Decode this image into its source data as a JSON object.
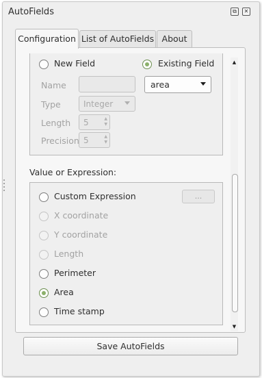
{
  "window": {
    "title": "AutoFields",
    "float_button": "⧉",
    "close_button": "✕"
  },
  "tabs": [
    {
      "label": "Configuration",
      "active": true
    },
    {
      "label": "List of AutoFields",
      "active": false
    },
    {
      "label": "About",
      "active": false
    }
  ],
  "field_target": {
    "new_field_label": "New Field",
    "existing_field_label": "Existing Field",
    "selected": "Existing Field",
    "existing_field_value": "area",
    "name_label": "Name",
    "name_value": "",
    "type_label": "Type",
    "type_value": "Integer",
    "length_label": "Length",
    "length_value": "5",
    "precision_label": "Precision",
    "precision_value": "5"
  },
  "value_section": {
    "heading": "Value or Expression:",
    "ellipsis_label": "...",
    "selected": "Area",
    "options": [
      {
        "label": "Custom Expression",
        "enabled": true
      },
      {
        "label": "X coordinate",
        "enabled": false
      },
      {
        "label": "Y coordinate",
        "enabled": false
      },
      {
        "label": "Length",
        "enabled": false
      },
      {
        "label": "Perimeter",
        "enabled": true
      },
      {
        "label": "Area",
        "enabled": true
      },
      {
        "label": "Time stamp",
        "enabled": true
      }
    ]
  },
  "save_button_label": "Save AutoFields",
  "colors": {
    "panel_bg": "#efefef",
    "radio_checked": "#8bb06a",
    "disabled_text": "#a2a2a2"
  }
}
